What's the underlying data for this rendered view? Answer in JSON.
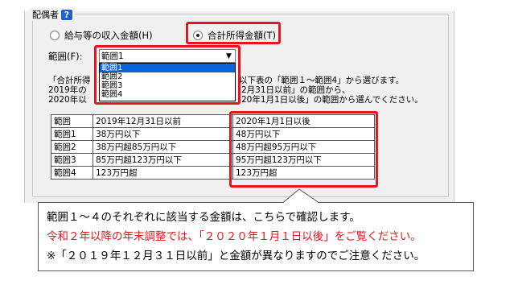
{
  "groupbox": {
    "legend": "配偶者",
    "help_glyph": "?"
  },
  "income_type": {
    "option_salary": "給与等の収入金額(H)",
    "option_total": "合計所得金額(T)",
    "selected": "option_total"
  },
  "range_select": {
    "label": "範囲(F):",
    "value": "範囲1",
    "options": [
      "範囲1",
      "範囲2",
      "範囲3",
      "範囲4"
    ],
    "highlighted": "範囲1"
  },
  "description": {
    "line1_left": "「合計所得",
    "line1_right": "以下表の「範囲１～範囲4」から選びます。",
    "line2_left": "2019年の",
    "line2_right": "2月31日以前」の範囲から、",
    "line3_left": "2020年以",
    "line3_right": "20年1月1日以後」の範囲から選んでください。"
  },
  "table": {
    "headers": [
      "範囲",
      "2019年12月31日以前",
      "2020年1月1日以後"
    ],
    "rows": [
      [
        "範囲1",
        "38万円以下",
        "48万円以下"
      ],
      [
        "範囲2",
        "38万円超85万円以下",
        "48万円超95万円以下"
      ],
      [
        "範囲3",
        "85万円超123万円以下",
        "95万円超123万円以下"
      ],
      [
        "範囲4",
        "123万円超",
        "123万円超"
      ]
    ]
  },
  "callout": {
    "line1": "範囲１～４のそれぞれに該当する金額は、こちらで確認します。",
    "line2": "令和２年以降の年末調整では、「２０２０年１月１日以後」をご覧ください。",
    "line3": "※「２０１９年１２月３１日以前」と金額が異なりますのでご注意ください。"
  },
  "colors": {
    "highlight_red": "#e8141e",
    "selection_blue": "#0a64d8",
    "help_blue": "#1f61c9",
    "panel_gray": "#f0f0f0"
  }
}
